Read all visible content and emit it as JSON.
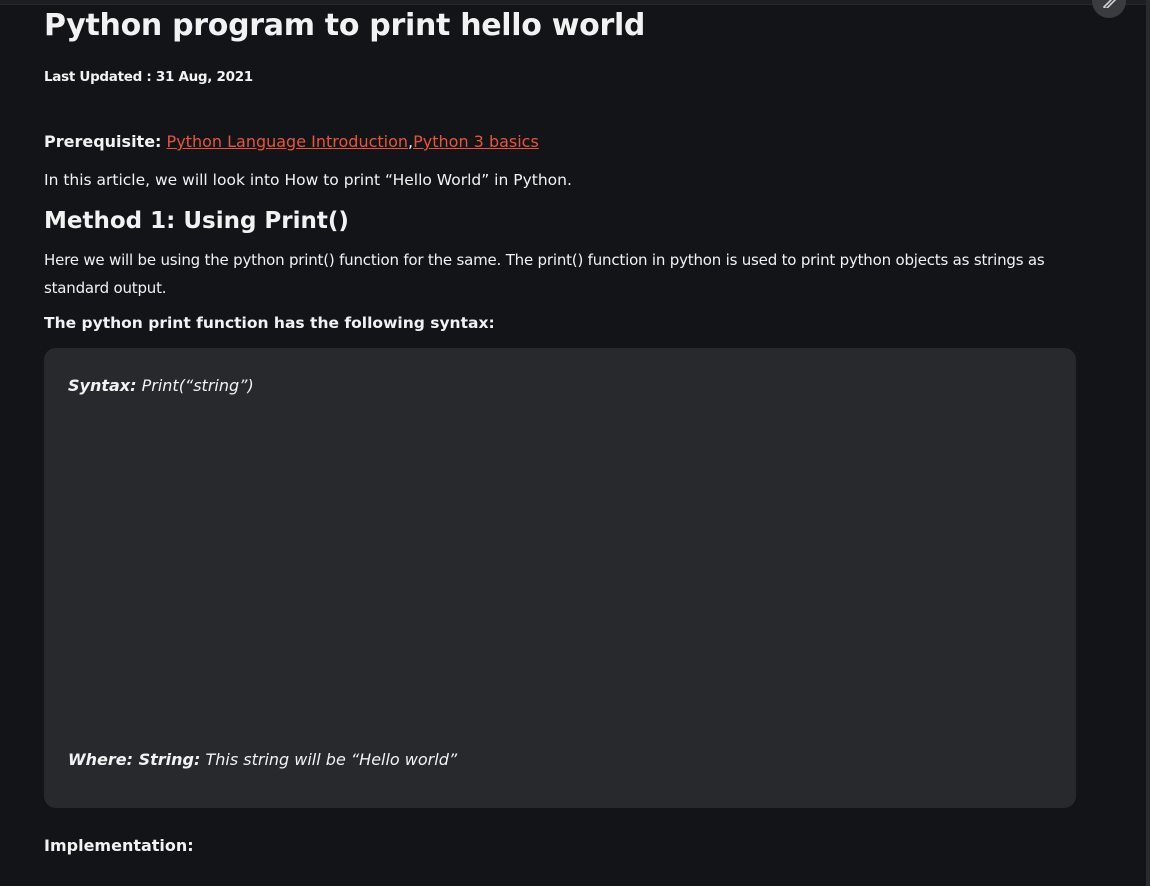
{
  "article": {
    "title": "Python program to print hello world",
    "last_updated": "Last Updated : 31 Aug, 2021",
    "prerequisite_label": "Prerequisite:",
    "prerequisite_links": [
      "Python Language Introduction",
      "Python 3 basics"
    ],
    "prerequisite_separator": ",",
    "intro": "In this article, we will look into How to print “Hello World” in Python.",
    "method_heading": "Method 1: Using Print()",
    "method_paragraph": "Here we will be using the python print() function for the same. The print() function in python is used to print python objects as strings as standard output.",
    "syntax_lead": "The python print function has the following syntax:",
    "syntax_box": {
      "syntax_label": "Syntax:",
      "syntax_value": " Print(“string”)",
      "where_label": "Where: String:",
      "where_value": " This string will be “Hello world”"
    },
    "implementation_heading": "Implementation:"
  },
  "icons": {
    "edit": "pencil-icon"
  },
  "colors": {
    "background": "#131417",
    "card": "#28292d",
    "link": "#e8553b",
    "text": "#f2f2f2"
  }
}
